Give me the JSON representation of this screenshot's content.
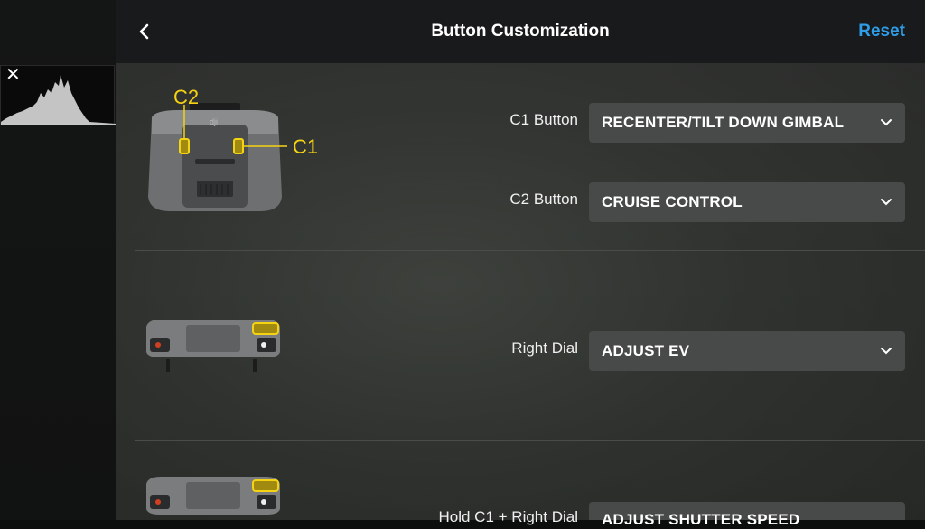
{
  "header": {
    "title": "Button Customization",
    "reset_label": "Reset"
  },
  "histogram": {
    "close_glyph": "✕"
  },
  "sections": {
    "top": {
      "callouts": {
        "c2": "C2",
        "c1": "C1"
      },
      "rows": [
        {
          "label": "C1 Button",
          "value": "RECENTER/TILT DOWN GIMBAL"
        },
        {
          "label": "C2 Button",
          "value": "CRUISE CONTROL"
        }
      ]
    },
    "middle": {
      "rows": [
        {
          "label": "Right Dial",
          "value": "ADJUST EV"
        }
      ]
    },
    "bottom": {
      "rows": [
        {
          "label": "Hold C1 + Right Dial",
          "value": "ADJUST SHUTTER SPEED"
        }
      ]
    }
  },
  "colors": {
    "accent": "#2f9ee8",
    "highlight": "#f5d313",
    "header_bg": "#191a1b",
    "select_bg": "#484a4a"
  },
  "icons": [
    "back-chevron-icon",
    "close-icon",
    "chevron-down-icon"
  ]
}
